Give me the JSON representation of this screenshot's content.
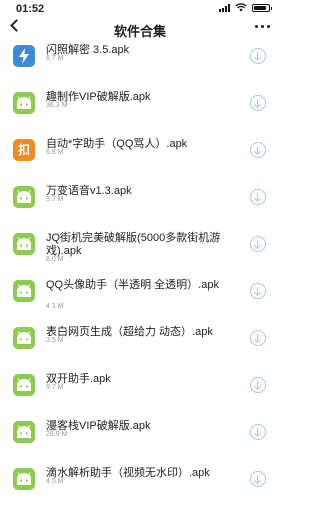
{
  "status": {
    "time": "01:52"
  },
  "nav": {
    "title": "软件合集"
  },
  "files": [
    {
      "name": "闪照解密 3.5.apk",
      "size": "6.7 M",
      "icon": "flash-icon"
    },
    {
      "name": "趣制作VIP破解版.apk",
      "size": "36.3 M",
      "icon": "android-icon"
    },
    {
      "name": "自动*字助手（QQ骂人）.apk",
      "size": "6.8 M",
      "icon": "helper-app-icon",
      "icon_text": "扣"
    },
    {
      "name": "万变语音v1.3.apk",
      "size": "3.7 M",
      "icon": "android-icon"
    },
    {
      "name": "JQ街机完美破解版(5000多款街机游戏).apk",
      "size": "8.0 M",
      "icon": "android-icon"
    },
    {
      "name": "QQ头像助手（半透明 全透明）.apk",
      "size": "4.1 M",
      "icon": "android-icon"
    },
    {
      "name": "表白网页生成（超给力 动态）.apk",
      "size": "3.5 M",
      "icon": "android-icon"
    },
    {
      "name": "双开助手.apk",
      "size": "9.7 M",
      "icon": "android-icon"
    },
    {
      "name": "漫客栈VIP破解版.apk",
      "size": "28.9 M",
      "icon": "android-icon"
    },
    {
      "name": "滴水解析助手（视频无水印）.apk",
      "size": "4.5 M",
      "icon": "android-icon"
    }
  ]
}
